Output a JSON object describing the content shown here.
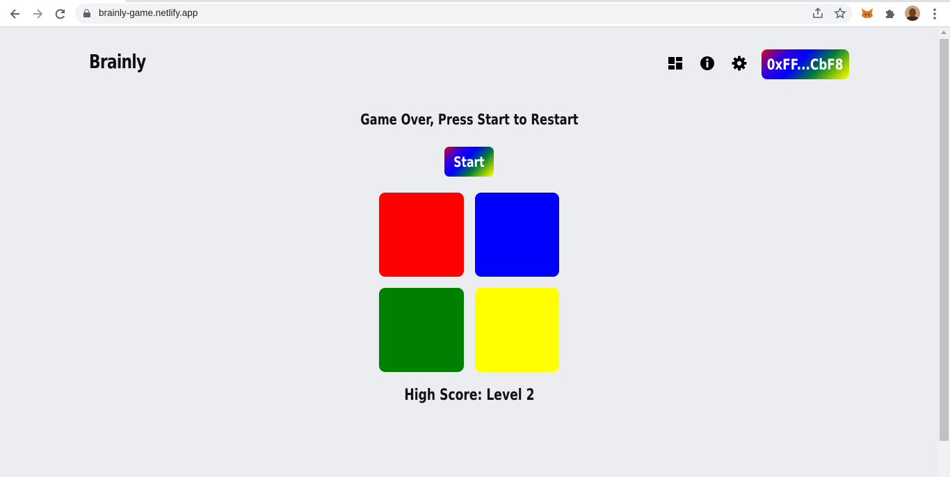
{
  "browser": {
    "url": "brainly-game.netlify.app"
  },
  "header": {
    "brand": "Brainly",
    "wallet_address": "0xFF...CbF8",
    "icons": [
      "dashboard-icon",
      "info-icon",
      "settings-icon"
    ]
  },
  "game": {
    "status": "Game Over, Press Start to Restart",
    "start_label": "Start",
    "high_score": "High Score: Level 2",
    "pads": [
      {
        "name": "red-pad",
        "color": "#ff0000"
      },
      {
        "name": "blue-pad",
        "color": "#0000ff"
      },
      {
        "name": "green-pad",
        "color": "#008000"
      },
      {
        "name": "yellow-pad",
        "color": "#ffff00"
      }
    ]
  }
}
